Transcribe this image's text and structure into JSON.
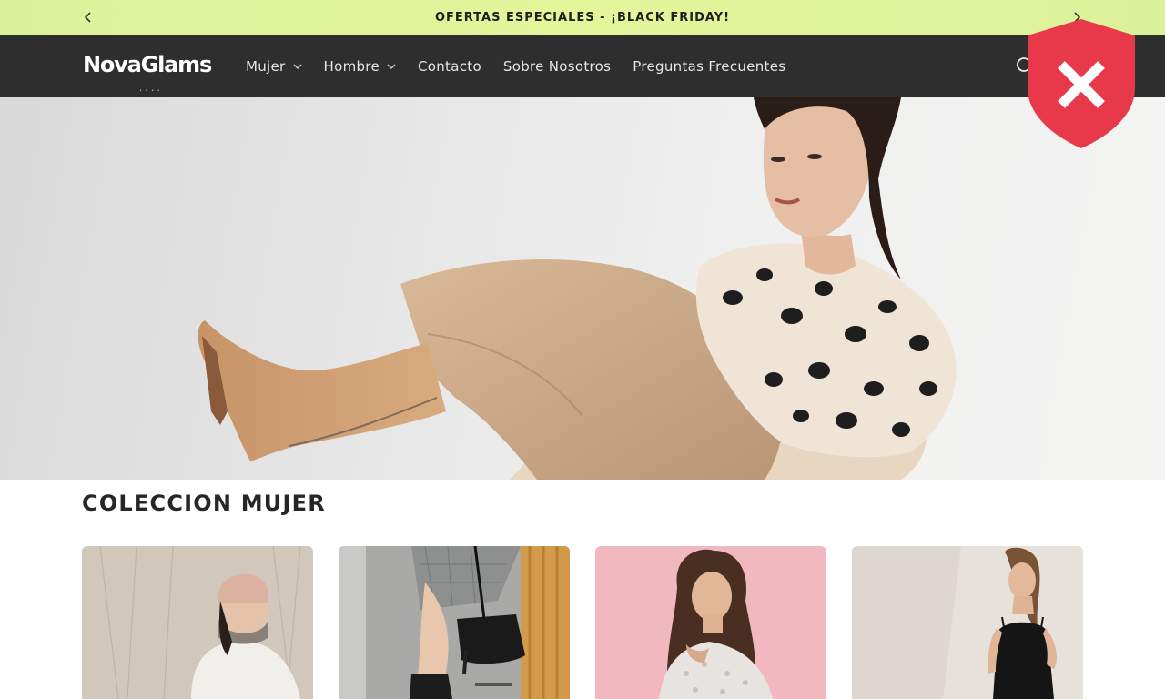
{
  "announcement": {
    "text": "OFERTAS ESPECIALES - ¡BLACK FRIDAY!",
    "prev_icon": "chevron-left-icon",
    "next_icon": "chevron-right-icon"
  },
  "header": {
    "logo_text": "NovaGlams",
    "logo_subtext": "• • • •",
    "nav": [
      {
        "label": "Mujer",
        "has_dropdown": true
      },
      {
        "label": "Hombre",
        "has_dropdown": true
      },
      {
        "label": "Contacto",
        "has_dropdown": false
      },
      {
        "label": "Sobre Nosotros",
        "has_dropdown": false
      },
      {
        "label": "Preguntas Frecuentes",
        "has_dropdown": false
      }
    ],
    "search_icon": "search-icon"
  },
  "overlay_badge": {
    "icon": "shield-x-icon",
    "color": "#e8394b"
  },
  "hero": {
    "image": "woman-leopard-blouse-beige-boots"
  },
  "collection": {
    "title": "COLECCION MUJER",
    "cards": [
      {
        "image": "woman-pink-beanie-white-coat"
      },
      {
        "image": "woman-plaid-skirt-black-bag"
      },
      {
        "image": "woman-sequin-top-pink-bg"
      },
      {
        "image": "woman-black-slip-dress"
      }
    ]
  },
  "colors": {
    "announcement_bg": "#e0f39a",
    "header_bg": "#2e2e2e",
    "badge_red": "#e8394b"
  }
}
